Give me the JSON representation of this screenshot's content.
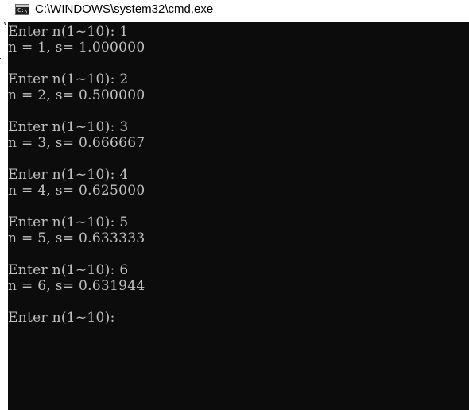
{
  "window": {
    "title": "C:\\WINDOWS\\system32\\cmd.exe",
    "icon": "cmd-icon"
  },
  "behind_window_fragments": [
    "“(",
    "ι",
    "."
  ],
  "console": {
    "lines": [
      "Enter n(1~10): 1",
      "n = 1, s= 1.000000",
      "",
      "Enter n(1~10): 2",
      "n = 2, s= 0.500000",
      "",
      "Enter n(1~10): 3",
      "n = 3, s= 0.666667",
      "",
      "Enter n(1~10): 4",
      "n = 4, s= 0.625000",
      "",
      "Enter n(1~10): 5",
      "n = 5, s= 0.633333",
      "",
      "Enter n(1~10): 6",
      "n = 6, s= 0.631944",
      "",
      "Enter n(1~10): "
    ]
  },
  "colors": {
    "console_background": "#0c0c0c",
    "console_text": "#c0c0c0",
    "titlebar_background": "#ffffff"
  }
}
